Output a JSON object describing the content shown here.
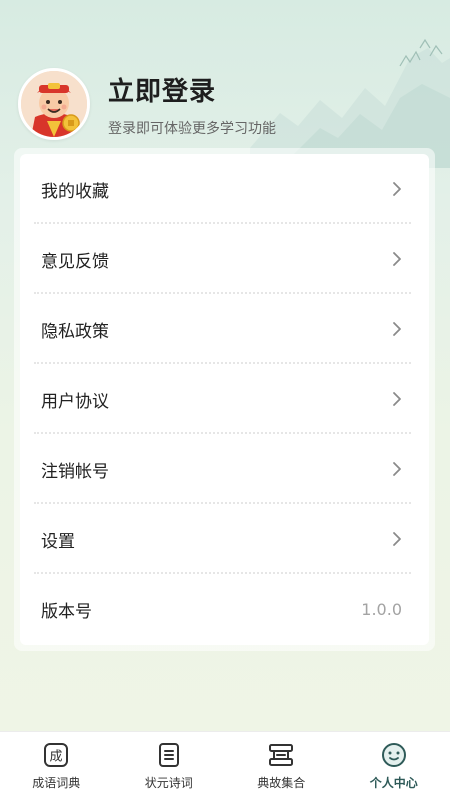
{
  "header": {
    "title": "立即登录",
    "subtitle": "登录即可体验更多学习功能"
  },
  "menu": {
    "items": [
      {
        "label": "我的收藏",
        "icon": "chevron-right-icon"
      },
      {
        "label": "意见反馈",
        "icon": "chevron-right-icon"
      },
      {
        "label": "隐私政策",
        "icon": "chevron-right-icon"
      },
      {
        "label": "用户协议",
        "icon": "chevron-right-icon"
      },
      {
        "label": "注销帐号",
        "icon": "chevron-right-icon"
      },
      {
        "label": "设置",
        "icon": "chevron-right-icon"
      },
      {
        "label": "版本号",
        "value": "1.0.0"
      }
    ]
  },
  "tabbar": {
    "tabs": [
      {
        "label": "成语词典",
        "icon": "idiom-dictionary-icon",
        "glyph": "成"
      },
      {
        "label": "状元诗词",
        "icon": "poetry-scroll-icon"
      },
      {
        "label": "典故集合",
        "icon": "stories-book-icon"
      },
      {
        "label": "个人中心",
        "icon": "profile-face-icon",
        "active": true
      }
    ]
  },
  "colors": {
    "accent": "#2e5a58",
    "background_top": "#d7ebe2",
    "background_bottom": "#f0f5e6",
    "muted_text": "#a3a3a3"
  }
}
